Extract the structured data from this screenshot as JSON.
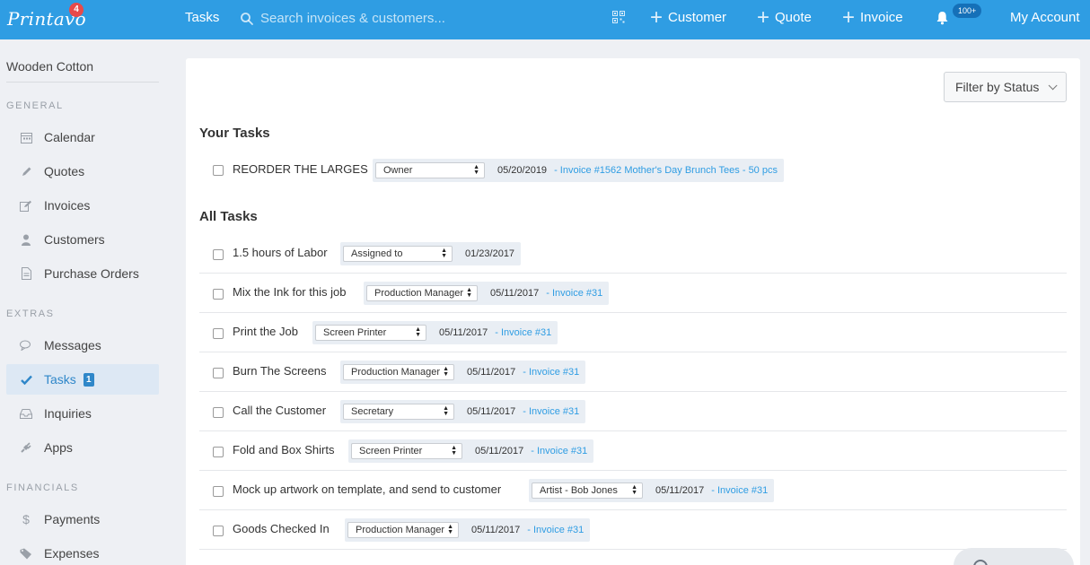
{
  "topbar": {
    "logo": "Printavo",
    "logo_badge": "4",
    "nav_tasks": "Tasks",
    "search_placeholder": "Search invoices & customers...",
    "customer_btn": "Customer",
    "quote_btn": "Quote",
    "invoice_btn": "Invoice",
    "notifications_badge": "100+",
    "my_account": "My Account"
  },
  "sidebar": {
    "company": "Wooden Cotton",
    "sections": {
      "general": "GENERAL",
      "extras": "EXTRAS",
      "financials": "FINANCIALS"
    },
    "items": [
      {
        "label": "Calendar",
        "icon": "calendar-icon"
      },
      {
        "label": "Quotes",
        "icon": "pencil-icon"
      },
      {
        "label": "Invoices",
        "icon": "edit-icon"
      },
      {
        "label": "Customers",
        "icon": "user-icon"
      },
      {
        "label": "Purchase Orders",
        "icon": "document-icon"
      },
      {
        "label": "Messages",
        "icon": "chat-icon"
      },
      {
        "label": "Tasks",
        "icon": "check-icon",
        "badge": "1",
        "active": true
      },
      {
        "label": "Inquiries",
        "icon": "inbox-icon"
      },
      {
        "label": "Apps",
        "icon": "plug-icon"
      },
      {
        "label": "Payments",
        "icon": "dollar-icon"
      },
      {
        "label": "Expenses",
        "icon": "tag-icon"
      }
    ]
  },
  "main": {
    "filter_button": "Filter by Status",
    "your_tasks_heading": "Your Tasks",
    "all_tasks_heading": "All Tasks",
    "your_tasks": [
      {
        "title": "REORDER THE LARGES",
        "assignee": "Owner",
        "date": "05/20/2019",
        "link": "- Invoice #1562 Mother's Day Brunch Tees - 50 pcs"
      }
    ],
    "all_tasks": [
      {
        "title": "1.5 hours of Labor",
        "assignee": "Assigned to",
        "date": "01/23/2017",
        "link": ""
      },
      {
        "title": "Mix the Ink for this job",
        "assignee": "Production Manager",
        "date": "05/11/2017",
        "link": "- Invoice #31"
      },
      {
        "title": "Print the Job",
        "assignee": "Screen Printer",
        "date": "05/11/2017",
        "link": "- Invoice #31"
      },
      {
        "title": "Burn The Screens",
        "assignee": "Production Manager",
        "date": "05/11/2017",
        "link": "- Invoice #31"
      },
      {
        "title": "Call the Customer",
        "assignee": "Secretary",
        "date": "05/11/2017",
        "link": "- Invoice #31"
      },
      {
        "title": "Fold and Box Shirts",
        "assignee": "Screen Printer",
        "date": "05/11/2017",
        "link": "- Invoice #31"
      },
      {
        "title": "Mock up artwork on template, and send to customer",
        "assignee": "Artist - Bob Jones",
        "date": "05/11/2017",
        "link": "- Invoice #31"
      },
      {
        "title": "Goods Checked In",
        "assignee": "Production Manager",
        "date": "05/11/2017",
        "link": "- Invoice #31"
      }
    ]
  },
  "colors": {
    "topbar": "#2f9de3",
    "link": "#2f9de3",
    "active_nav": "#2f87c9",
    "alert_badge": "#e84a4a"
  }
}
